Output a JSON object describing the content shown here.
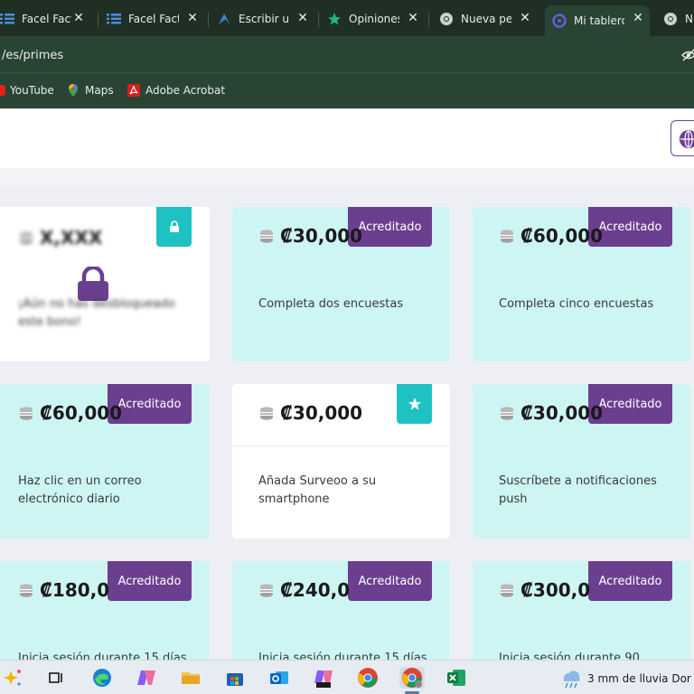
{
  "browser": {
    "tabs": [
      {
        "label": "Facel Factu",
        "icon": "list-icon"
      },
      {
        "label": "Facel Factu",
        "icon": "list-icon"
      },
      {
        "label": "Escribir un",
        "icon": "ai-star-icon"
      },
      {
        "label": "Opiniones",
        "icon": "star-icon"
      },
      {
        "label": "Nueva pest",
        "icon": "chrome-icon"
      },
      {
        "label": "Mi tablero",
        "icon": "dashboard-icon"
      },
      {
        "label": "N",
        "icon": "chrome-icon"
      }
    ],
    "url": "/es/primes",
    "bookmarks": [
      {
        "label": "YouTube"
      },
      {
        "label": "Maps"
      },
      {
        "label": "Adobe Acrobat"
      }
    ]
  },
  "cards": [
    {
      "amount": "X,XXX",
      "desc": "¡Aún no has desbloqueado este bono!",
      "state": "locked"
    },
    {
      "amount": "₡30,000",
      "desc": "Completa dos encuestas",
      "state": "credited",
      "badge": "Acreditado"
    },
    {
      "amount": "₡60,000",
      "desc": "Completa cinco encuestas",
      "state": "credited",
      "badge": "Acreditado"
    },
    {
      "amount": "₡60,000",
      "desc": "Haz clic en un correo electrónico diario",
      "state": "credited",
      "badge": "Acreditado"
    },
    {
      "amount": "₡30,000",
      "desc": "Añada Surveoo a su smartphone",
      "state": "starred"
    },
    {
      "amount": "₡30,000",
      "desc": "Suscríbete a notificaciones push",
      "state": "credited",
      "badge": "Acreditado"
    },
    {
      "amount": "₡180,0",
      "desc": "Inicia sesión durante 15 días",
      "state": "credited",
      "badge": "Acreditado"
    },
    {
      "amount": "₡240,0",
      "desc": "Inicia sesión durante 15 días",
      "state": "credited",
      "badge": "Acreditado"
    },
    {
      "amount": "₡300,0",
      "desc": "Inicia sesión durante 90",
      "state": "credited",
      "badge": "Acreditado"
    }
  ],
  "taskbar": {
    "weather": "3 mm de lluvia Dor"
  },
  "colors": {
    "chrome_dark": "#1f2f24",
    "chrome": "#2a4434",
    "card_mint": "#cdf5f3",
    "badge_purple": "#6b3f8f",
    "teal": "#1ec2c2"
  }
}
